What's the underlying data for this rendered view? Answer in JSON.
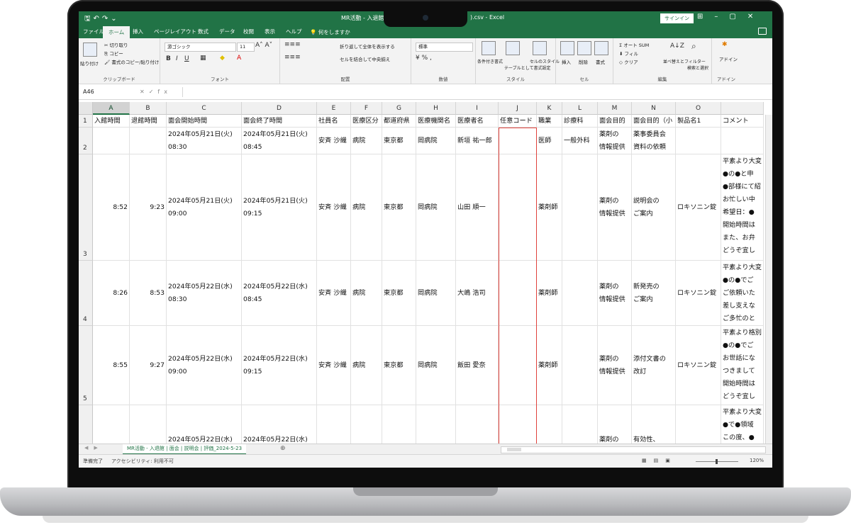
{
  "app": {
    "title": "MR活動 - 入退館",
    "title_suffix": ").csv - Excel",
    "sign_in": "サインイン",
    "name_box": "A46",
    "sheet_tab": "MR活動 - 入退館 | 面会 | 説明会 | 評価_2024-5-23",
    "status_ready": "準備完了",
    "status_accessibility": "アクセシビリティ: 利用不可",
    "zoom": "120%"
  },
  "ribbon_tabs": [
    "ファイル",
    "ホーム",
    "挿入",
    "ページレイアウト",
    "数式",
    "データ",
    "校閲",
    "表示",
    "ヘルプ"
  ],
  "ribbon_search": "何をしますか",
  "ribbon": {
    "clipboard": {
      "paste": "貼り付け",
      "cut": "切り取り",
      "copy": "コピー",
      "format_painter": "書式のコピー/貼り付け",
      "label": "クリップボード"
    },
    "font": {
      "name": "游ゴシック",
      "size": "11",
      "label": "フォント"
    },
    "alignment": {
      "wrap": "折り返して全体を表示する",
      "merge": "セルを結合して中央揃え",
      "label": "配置"
    },
    "number": {
      "format": "標準",
      "label": "数値"
    },
    "styles": {
      "conditional": "条件付き書式",
      "table": "テーブルとして書式設定",
      "cell": "セルのスタイル",
      "label": "スタイル"
    },
    "cells": {
      "insert": "挿入",
      "delete": "削除",
      "format": "書式",
      "label": "セル"
    },
    "editing": {
      "autosum": "オート SUM",
      "fill": "フィル",
      "clear": "クリア",
      "sort": "並べ替えとフィルター",
      "find": "検索と選択",
      "label": "編集"
    },
    "addins": {
      "addin": "アドイン",
      "label": "アドイン"
    }
  },
  "columns": [
    "A",
    "B",
    "C",
    "D",
    "E",
    "F",
    "G",
    "H",
    "I",
    "J",
    "K",
    "L",
    "M",
    "N",
    "O",
    ""
  ],
  "selected_column": "A",
  "headers": [
    "入館時間",
    "退館時間",
    "面会開始時間",
    "面会終了時間",
    "社員名",
    "医療区分",
    "都道府県",
    "医療機関名",
    "医療者名",
    "任意コード",
    "職業",
    "診療科",
    "面会目的",
    "面会目的（小",
    "製品名1",
    "コメント"
  ],
  "rows": [
    {
      "num": "2",
      "cells": [
        "",
        "",
        [
          "2024年05月21日(火)",
          "08:30"
        ],
        [
          "2024年05月21日(火)",
          "08:45"
        ],
        "安斉 沙織",
        "病院",
        "東京都",
        "岡病院",
        "新垣 祐一郎",
        "",
        "医師",
        "一般外科",
        [
          "薬剤の",
          "情報提供"
        ],
        [
          "薬事委員会",
          "資料の依頼"
        ],
        "",
        ""
      ]
    },
    {
      "num": "3",
      "cells": [
        "8:52",
        "9:23",
        [
          "2024年05月21日(火)",
          "09:00"
        ],
        [
          "2024年05月21日(火)",
          "09:15"
        ],
        "安斉 沙織",
        "病院",
        "東京都",
        "岡病院",
        "山田 順一",
        "",
        "薬剤師",
        "",
        [
          "薬剤の",
          "情報提供"
        ],
        [
          "説明会の",
          "ご案内"
        ],
        "ロキソニン錠",
        [
          "平素より大変",
          "●の●と申",
          "●部様にて紹",
          "お忙しい中",
          "希望日：●",
          "開始時間は",
          "また、お弁",
          "どうぞ宜し"
        ]
      ]
    },
    {
      "num": "4",
      "cells": [
        "8:26",
        "8:53",
        [
          "2024年05月22日(水)",
          "08:30"
        ],
        [
          "2024年05月22日(水)",
          "08:45"
        ],
        "安斉 沙織",
        "病院",
        "東京都",
        "岡病院",
        "大嶋 浩司",
        "",
        "薬剤師",
        "",
        [
          "薬剤の",
          "情報提供"
        ],
        [
          "新発売の",
          "ご案内"
        ],
        "ロキソニン錠",
        [
          "平素より大変",
          "●の●でご",
          "ご依頼いた",
          "差し支えな",
          "ご多忙のと"
        ]
      ]
    },
    {
      "num": "5",
      "cells": [
        "8:55",
        "9:27",
        [
          "2024年05月22日(水)",
          "09:00"
        ],
        [
          "2024年05月22日(水)",
          "09:15"
        ],
        "安斉 沙織",
        "病院",
        "東京都",
        "岡病院",
        "飯田 愛奈",
        "",
        "薬剤師",
        "",
        [
          "薬剤の",
          "情報提供"
        ],
        [
          "添付文書の",
          "改訂"
        ],
        "ロキソニン錠",
        [
          "平素より格別",
          "●の●でご",
          "お世話にな",
          "つきまして",
          "開始時間は",
          "どうぞ宜し"
        ]
      ]
    },
    {
      "num": "",
      "cells": [
        "",
        "",
        [
          "",
          "2024年05月22日(水)"
        ],
        [
          "",
          "2024年05月22日(水)"
        ],
        "",
        "",
        "",
        "",
        "",
        "",
        "",
        "",
        [
          "",
          "薬剤の"
        ],
        [
          "",
          "有効性、"
        ],
        "",
        [
          "平素より大変",
          "●で●領域",
          "この度、●"
        ]
      ]
    }
  ]
}
